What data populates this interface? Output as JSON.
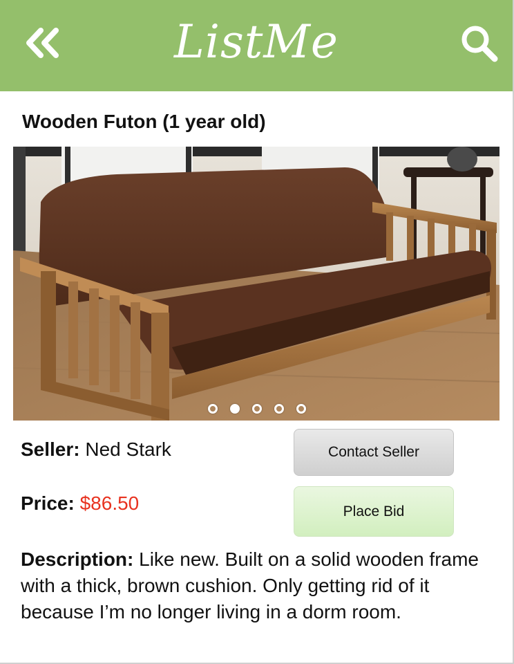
{
  "app": {
    "logo": "ListMe",
    "brand_color": "#94bf6b"
  },
  "header": {
    "back_icon": "double-chevron-left-icon",
    "search_icon": "search-icon"
  },
  "listing": {
    "title": "Wooden Futon (1 year old)",
    "image_description_icon": "futon-photo",
    "carousel": {
      "count": 5,
      "active_index": 1
    },
    "seller_label": "Seller:",
    "seller_name": "Ned Stark",
    "price_label": "Price:",
    "price": "$86.50",
    "price_color": "#e8321f",
    "description_label": "Description:",
    "description": "Like new. Built on a solid wooden frame with a thick, brown cushion. Only getting rid of it because I’m no longer living in a dorm room."
  },
  "actions": {
    "contact_label": "Contact Seller",
    "bid_label": "Place Bid"
  }
}
